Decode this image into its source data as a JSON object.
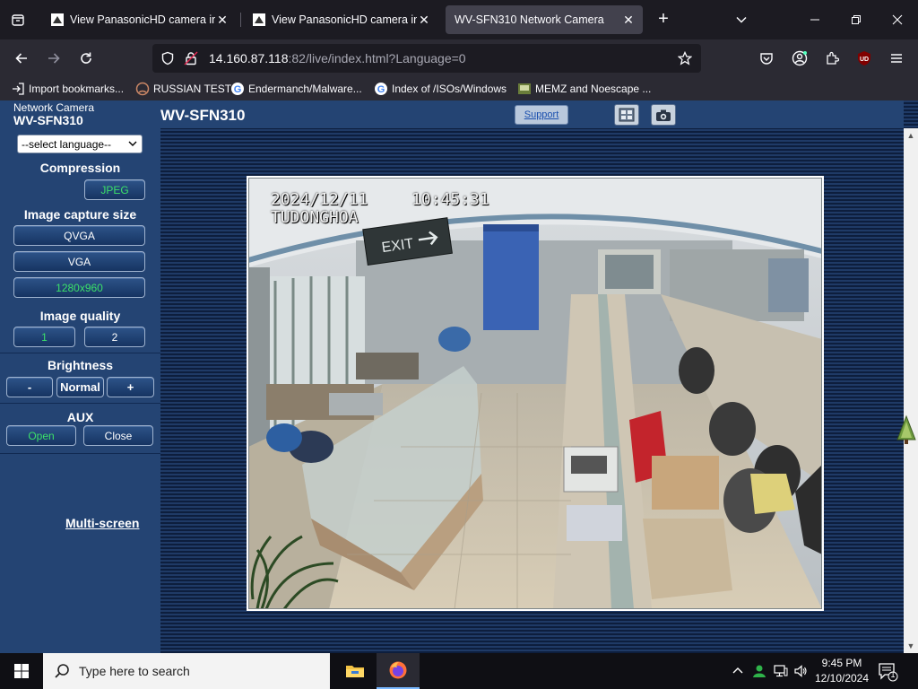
{
  "browser": {
    "tabs": [
      {
        "title": "View PanasonicHD camera in Ja",
        "active": false
      },
      {
        "title": "View PanasonicHD camera in Vi",
        "active": false
      },
      {
        "title": "WV-SFN310 Network Camera",
        "active": true
      }
    ],
    "url": {
      "host": "14.160.87.118",
      "rest": ":82/live/index.html?Language=0"
    },
    "bookmarks": [
      {
        "label": "Import bookmarks..."
      },
      {
        "label": "RUSSIAN TEST"
      },
      {
        "label": "Endermanch/Malware..."
      },
      {
        "label": "Index of /ISOs/Windows"
      },
      {
        "label": "MEMZ and Noescape ..."
      }
    ]
  },
  "camera": {
    "header_small": "Network Camera",
    "header_model": "WV-SFN310",
    "title": "WV-SFN310",
    "support_label": "Support",
    "language_select": "--select language--",
    "compression": {
      "label": "Compression",
      "value": "JPEG"
    },
    "capture_size": {
      "label": "Image capture size",
      "options": [
        "QVGA",
        "VGA",
        "1280x960"
      ],
      "selected": "1280x960"
    },
    "quality": {
      "label": "Image quality",
      "options": [
        "1",
        "2"
      ],
      "selected": "1"
    },
    "brightness": {
      "label": "Brightness",
      "minus": "-",
      "normal": "Normal",
      "plus": "+"
    },
    "aux": {
      "label": "AUX",
      "open": "Open",
      "close": "Close"
    },
    "multiscreen": "Multi-screen",
    "osd": {
      "date": "2024/12/11",
      "time": "10:45:31",
      "location": "TUDONGHOA"
    },
    "scene_sign": "EXIT"
  },
  "taskbar": {
    "search_placeholder": "Type here to search",
    "time": "9:45 PM",
    "date": "12/10/2024",
    "notification_count": "1"
  },
  "colors": {
    "accent_green": "#3be06a",
    "panel_blue": "#244473"
  }
}
